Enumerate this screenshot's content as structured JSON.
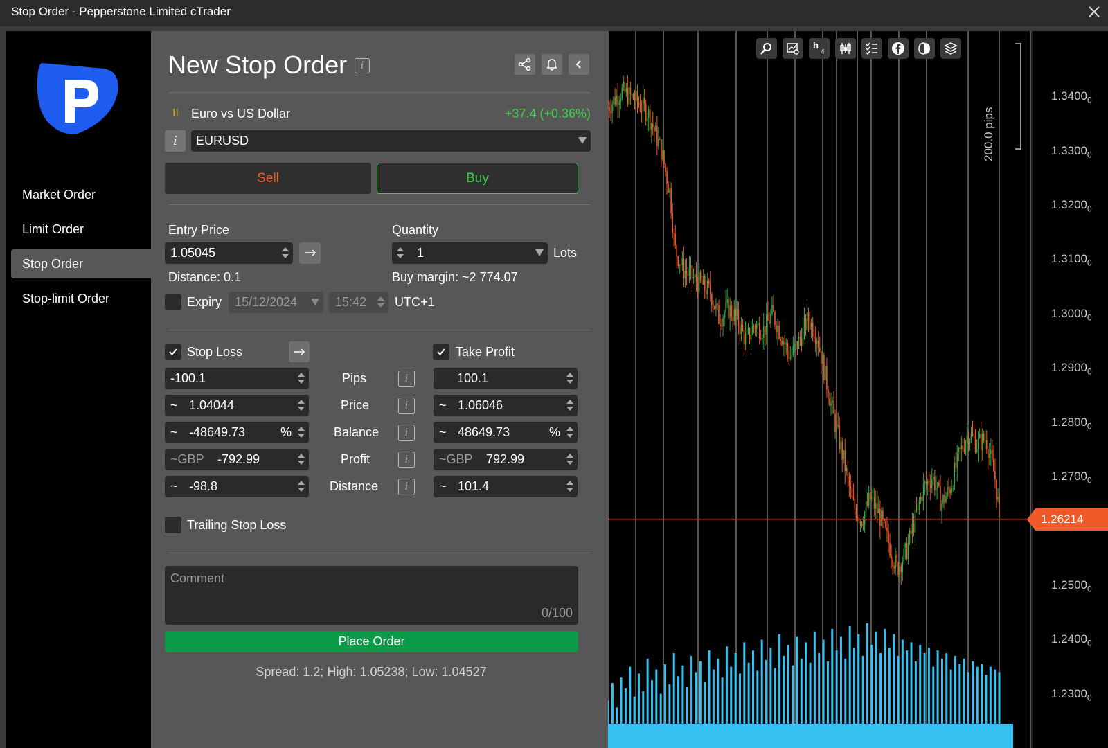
{
  "window": {
    "title": "Stop Order - Pepperstone Limited cTrader"
  },
  "sidebar": {
    "items": [
      {
        "label": "Market Order",
        "active": false
      },
      {
        "label": "Limit Order",
        "active": false
      },
      {
        "label": "Stop Order",
        "active": true
      },
      {
        "label": "Stop-limit Order",
        "active": false
      }
    ]
  },
  "order": {
    "title": "New Stop Order",
    "symbol_name": "Euro vs US Dollar",
    "change": "+37.4 (+0.36%)",
    "symbol": "EURUSD",
    "sell_label": "Sell",
    "buy_label": "Buy",
    "entry_price_label": "Entry Price",
    "entry_price": "1.05045",
    "quantity_label": "Quantity",
    "quantity": "1",
    "lots_label": "Lots",
    "distance": "Distance: 0.1",
    "buy_margin": "Buy margin: ~2 774.07",
    "expiry_label": "Expiry",
    "expiry_date": "15/12/2024",
    "expiry_time": "15:42",
    "timezone": "UTC+1",
    "stop_loss_label": "Stop Loss",
    "take_profit_label": "Take Profit",
    "rows": [
      {
        "label": "Pips",
        "sl_prefix": "",
        "sl": "-100.1",
        "sl_suffix": "",
        "tp_prefix": "",
        "tp": "100.1",
        "tp_suffix": ""
      },
      {
        "label": "Price",
        "sl_prefix": "~",
        "sl": "1.04044",
        "sl_suffix": "",
        "tp_prefix": "~",
        "tp": "1.06046",
        "tp_suffix": ""
      },
      {
        "label": "Balance",
        "sl_prefix": "~",
        "sl": "-48649.73",
        "sl_suffix": "%",
        "tp_prefix": "~",
        "tp": "48649.73",
        "tp_suffix": "%"
      },
      {
        "label": "Profit",
        "sl_prefix": "~GBP",
        "sl": "-792.99",
        "sl_suffix": "",
        "tp_prefix": "~GBP",
        "tp": "792.99",
        "tp_suffix": ""
      },
      {
        "label": "Distance",
        "sl_prefix": "~",
        "sl": "-98.8",
        "sl_suffix": "",
        "tp_prefix": "~",
        "tp": "101.4",
        "tp_suffix": ""
      }
    ],
    "trailing_label": "Trailing Stop Loss",
    "comment_placeholder": "Comment",
    "comment_count": "0/100",
    "place_order_label": "Place Order",
    "footer": "Spread: 1.2; High: 1.05238; Low: 1.04527"
  },
  "chart_data": {
    "type": "candlestick",
    "symbol": "EURUSD",
    "ylim": [
      1.22,
      1.345
    ],
    "yticks": [
      {
        "value": 1.34,
        "label": "1.3400",
        "suffix": "0"
      },
      {
        "value": 1.33,
        "label": "1.3300",
        "suffix": "0"
      },
      {
        "value": 1.32,
        "label": "1.3200",
        "suffix": "0"
      },
      {
        "value": 1.31,
        "label": "1.3100",
        "suffix": "0"
      },
      {
        "value": 1.3,
        "label": "1.3000",
        "suffix": "0"
      },
      {
        "value": 1.29,
        "label": "1.2900",
        "suffix": "0"
      },
      {
        "value": 1.28,
        "label": "1.2800",
        "suffix": "0"
      },
      {
        "value": 1.27,
        "label": "1.2700",
        "suffix": "0"
      },
      {
        "value": 1.25,
        "label": "1.2500",
        "suffix": "0"
      },
      {
        "value": 1.24,
        "label": "1.2400",
        "suffix": "0"
      },
      {
        "value": 1.23,
        "label": "1.2300",
        "suffix": "0"
      }
    ],
    "current_price": "1.26214",
    "current_price_value": 1.26214,
    "scale_label": "200.0 pips",
    "timeframe": {
      "letter": "h",
      "value": "4"
    },
    "series": [
      {
        "x": 0,
        "close": 1.338
      },
      {
        "x": 3,
        "close": 1.341
      },
      {
        "x": 6,
        "close": 1.3395
      },
      {
        "x": 9,
        "close": 1.337
      },
      {
        "x": 12,
        "close": 1.33
      },
      {
        "x": 14,
        "close": 1.322
      },
      {
        "x": 15,
        "close": 1.312
      },
      {
        "x": 17,
        "close": 1.308
      },
      {
        "x": 20,
        "close": 1.306
      },
      {
        "x": 23,
        "close": 1.304
      },
      {
        "x": 25,
        "close": 1.299
      },
      {
        "x": 27,
        "close": 1.301
      },
      {
        "x": 29,
        "close": 1.299
      },
      {
        "x": 31,
        "close": 1.295
      },
      {
        "x": 33,
        "close": 1.298
      },
      {
        "x": 35,
        "close": 1.297
      },
      {
        "x": 37,
        "close": 1.3
      },
      {
        "x": 39,
        "close": 1.296
      },
      {
        "x": 41,
        "close": 1.292
      },
      {
        "x": 43,
        "close": 1.295
      },
      {
        "x": 45,
        "close": 1.299
      },
      {
        "x": 47,
        "close": 1.296
      },
      {
        "x": 49,
        "close": 1.288
      },
      {
        "x": 51,
        "close": 1.28
      },
      {
        "x": 53,
        "close": 1.273
      },
      {
        "x": 55,
        "close": 1.265
      },
      {
        "x": 57,
        "close": 1.262
      },
      {
        "x": 59,
        "close": 1.266
      },
      {
        "x": 61,
        "close": 1.263
      },
      {
        "x": 63,
        "close": 1.258
      },
      {
        "x": 65,
        "close": 1.253
      },
      {
        "x": 67,
        "close": 1.256
      },
      {
        "x": 69,
        "close": 1.262
      },
      {
        "x": 71,
        "close": 1.268
      },
      {
        "x": 73,
        "close": 1.27
      },
      {
        "x": 75,
        "close": 1.265
      },
      {
        "x": 77,
        "close": 1.268
      },
      {
        "x": 79,
        "close": 1.274
      },
      {
        "x": 81,
        "close": 1.278
      },
      {
        "x": 83,
        "close": 1.276
      },
      {
        "x": 85,
        "close": 1.277
      },
      {
        "x": 87,
        "close": 1.27
      },
      {
        "x": 88,
        "close": 1.263
      }
    ],
    "volume": [
      35,
      48,
      30,
      52,
      44,
      60,
      38,
      55,
      42,
      66,
      50,
      58,
      40,
      62,
      47,
      70,
      53,
      61,
      45,
      68,
      56,
      64,
      49,
      72,
      58,
      66,
      52,
      75,
      60,
      70,
      55,
      78,
      63,
      72,
      57,
      80,
      65,
      74,
      59,
      84,
      68,
      76,
      61,
      82,
      66,
      78,
      63,
      86,
      70,
      80,
      64,
      88,
      72,
      82,
      66,
      90,
      74,
      84,
      68,
      92,
      76,
      86,
      70,
      88,
      74,
      84,
      68,
      80,
      72,
      78,
      64,
      76,
      70,
      74,
      60,
      72,
      66,
      70,
      58,
      68,
      62,
      66,
      56,
      64,
      60,
      62,
      54,
      60,
      58,
      56
    ]
  }
}
